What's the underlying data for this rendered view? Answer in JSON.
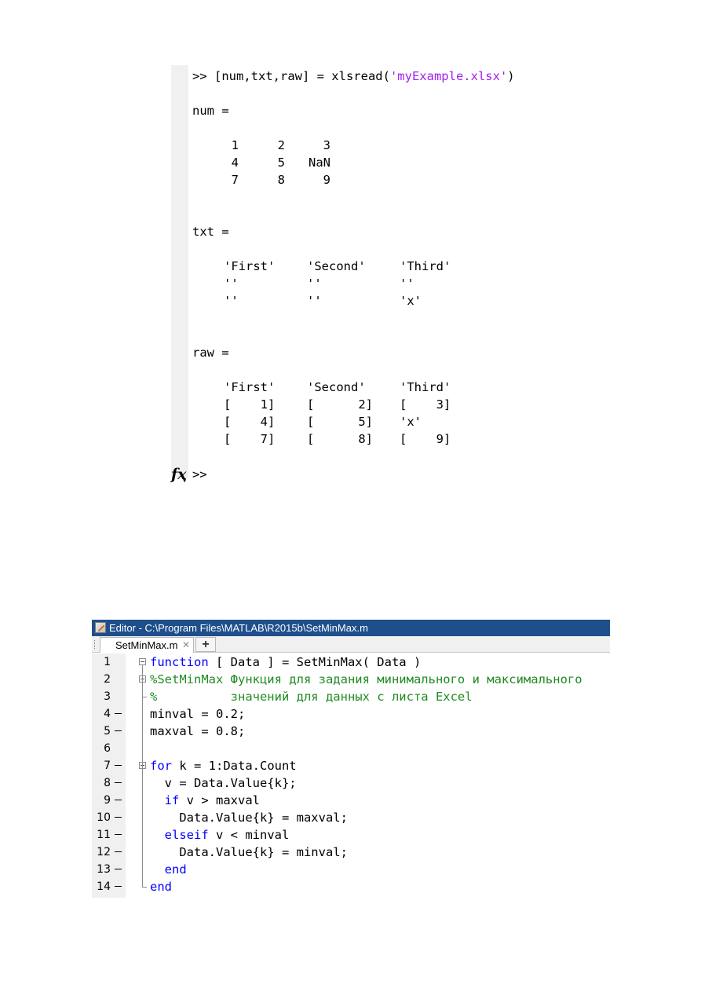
{
  "command_window": {
    "prompt_cmd": ">> [num,txt,raw] = xlsread(",
    "prompt_str": "'myExample.xlsx'",
    "prompt_close": ")",
    "num_label": "num =",
    "num_rows": [
      [
        "1",
        "2",
        "3"
      ],
      [
        "4",
        "5",
        "NaN"
      ],
      [
        "7",
        "8",
        "9"
      ]
    ],
    "txt_label": "txt =",
    "txt_rows": [
      [
        "'First'",
        "'Second'",
        "'Third'"
      ],
      [
        "''",
        "''",
        "''"
      ],
      [
        "''",
        "''",
        "'x'"
      ]
    ],
    "raw_label": "raw =",
    "raw_rows": [
      [
        "'First'",
        "'Second'",
        "'Third'"
      ],
      [
        "[    1]",
        "[      2]",
        "[    3]"
      ],
      [
        "[    4]",
        "[      5]",
        "'x'"
      ],
      [
        "[    7]",
        "[      8]",
        "[    9]"
      ]
    ],
    "fx_symbol": "fx",
    "final_prompt": ">>"
  },
  "editor": {
    "title": "Editor - C:\\Program Files\\MATLAB\\R2015b\\SetMinMax.m",
    "tab_label": "SetMinMax.m",
    "tab_close": "✕",
    "add_tab": "+",
    "lines": [
      {
        "num": "1",
        "segments": [
          {
            "t": "function",
            "c": "kw"
          },
          {
            "t": " [ Data ] = SetMinMax( Data )",
            "c": ""
          }
        ]
      },
      {
        "num": "2",
        "segments": [
          {
            "t": "%SetMinMax Функция для задания минимального и максимального",
            "c": "cm"
          }
        ]
      },
      {
        "num": "3",
        "segments": [
          {
            "t": "%          значений для данных с листа Excel",
            "c": "cm"
          }
        ]
      },
      {
        "num": "4",
        "segments": [
          {
            "t": "minval = 0.2;",
            "c": ""
          }
        ]
      },
      {
        "num": "5",
        "segments": [
          {
            "t": "maxval = 0.8;",
            "c": ""
          }
        ]
      },
      {
        "num": "6",
        "segments": []
      },
      {
        "num": "7",
        "segments": [
          {
            "t": "for",
            "c": "kw"
          },
          {
            "t": " k = 1:Data.Count",
            "c": ""
          }
        ]
      },
      {
        "num": "8",
        "segments": [
          {
            "t": "  v = Data.Value{k};",
            "c": ""
          }
        ]
      },
      {
        "num": "9",
        "segments": [
          {
            "t": "  ",
            "c": ""
          },
          {
            "t": "if",
            "c": "kw"
          },
          {
            "t": " v > maxval",
            "c": ""
          }
        ]
      },
      {
        "num": "10",
        "segments": [
          {
            "t": "    Data.Value{k} = maxval;",
            "c": ""
          }
        ]
      },
      {
        "num": "11",
        "segments": [
          {
            "t": "  ",
            "c": ""
          },
          {
            "t": "elseif",
            "c": "kw"
          },
          {
            "t": " v < minval",
            "c": ""
          }
        ]
      },
      {
        "num": "12",
        "segments": [
          {
            "t": "    Data.Value{k} = minval;",
            "c": ""
          }
        ]
      },
      {
        "num": "13",
        "segments": [
          {
            "t": "  ",
            "c": ""
          },
          {
            "t": "end",
            "c": "kw"
          }
        ]
      },
      {
        "num": "14",
        "segments": [
          {
            "t": "end",
            "c": "kw"
          }
        ]
      }
    ],
    "breakpoint_lines": [
      "4",
      "5",
      "7",
      "8",
      "9",
      "10",
      "11",
      "12",
      "13",
      "14"
    ]
  }
}
